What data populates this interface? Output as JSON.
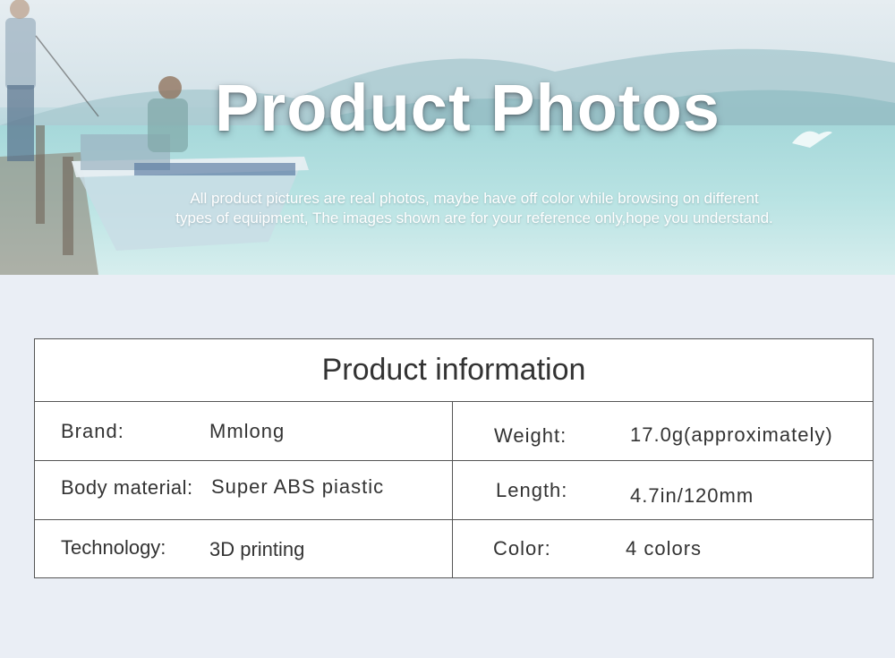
{
  "hero": {
    "title": "Product Photos",
    "subtitle_line1": "All product pictures are real photos, maybe have off color while browsing on different",
    "subtitle_line2": "types of equipment, The images shown are for your reference only,hope you understand."
  },
  "info": {
    "heading": "Product information",
    "rows": [
      {
        "left_label": "Brand:",
        "left_value": "Mmlong",
        "right_label": "Weight:",
        "right_value": "17.0g(approximately)"
      },
      {
        "left_label": "Body material:",
        "left_value": "Super ABS piastic",
        "right_label": "Length:",
        "right_value": "4.7in/120mm"
      },
      {
        "left_label": "Technology:",
        "left_value": "3D printing",
        "right_label": "Color:",
        "right_value": "4 colors"
      }
    ]
  }
}
